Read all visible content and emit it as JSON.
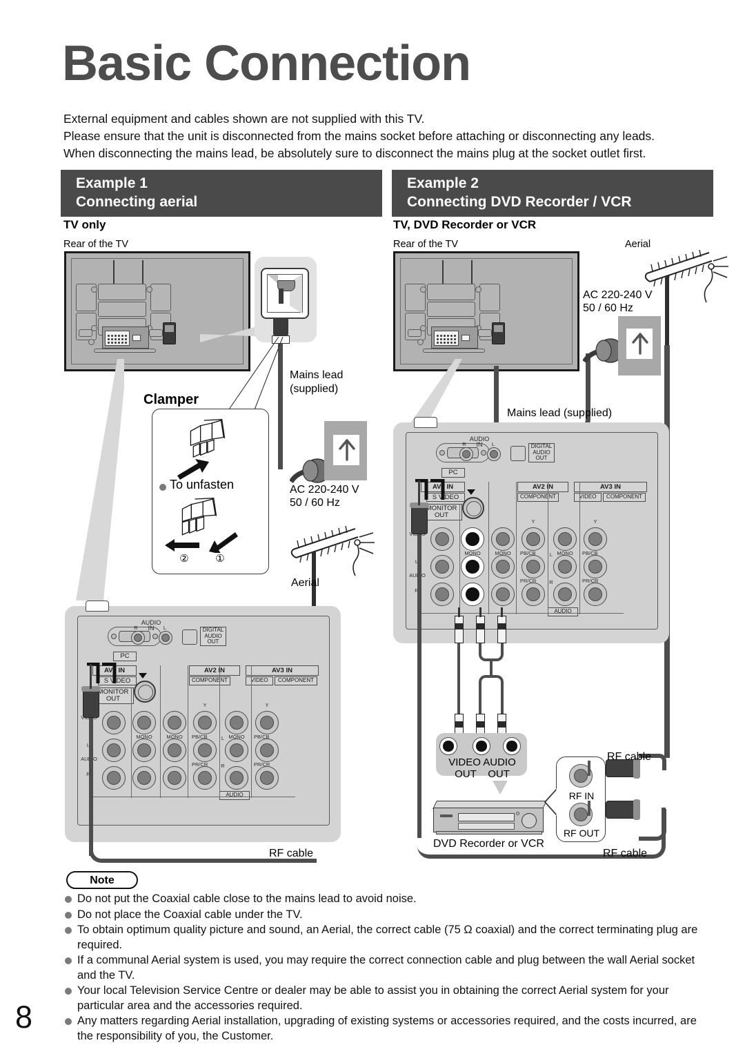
{
  "page": {
    "title": "Basic Connection",
    "page_number": "8",
    "intro_lines": [
      "External equipment and cables shown are not supplied with this TV.",
      "Please ensure that the unit is disconnected from the mains socket before attaching or disconnecting any leads.",
      "When disconnecting the mains lead, be absolutely sure to disconnect the mains plug at the socket outlet first."
    ]
  },
  "example1": {
    "header_line1": "Example 1",
    "header_line2": "Connecting aerial",
    "subtitle": "TV only",
    "tv_label": "Rear of the TV",
    "mains_lead_label": "Mains lead\n(supplied)",
    "mains_lead_line1": "Mains lead",
    "mains_lead_line2": "(supplied)",
    "ac_line1": "AC 220-240 V",
    "ac_line2": "50 / 60 Hz",
    "aerial_label": "Aerial",
    "rf_cable_label": "RF cable",
    "clamper": {
      "title": "Clamper",
      "unfasten_label": "To unfasten",
      "step1": "①",
      "step2": "②"
    }
  },
  "example2": {
    "header_line1": "Example 2",
    "header_line2": "Connecting DVD Recorder / VCR",
    "subtitle": "TV, DVD Recorder or VCR",
    "tv_label": "Rear of the TV",
    "aerial_label": "Aerial",
    "ac_line1": "AC 220-240 V",
    "ac_line2": "50 / 60 Hz",
    "mains_lead_label": "Mains lead (supplied)",
    "bubble_line1": "VIDEO AUDIO",
    "bubble_line2": "OUT      OUT",
    "bubble_video": "VIDEO",
    "bubble_audio": "AUDIO",
    "bubble_out1": "OUT",
    "bubble_out2": "OUT",
    "device_label": "DVD Recorder or VCR",
    "rf_in_label": "RF IN",
    "rf_out_label": "RF OUT",
    "rf_cable_top": "RF cable",
    "rf_cable_bottom": "RF cable"
  },
  "panel": {
    "pc_label": "PC",
    "audio_in_top": "AUDIO",
    "audio_in_mid": "IN",
    "audio_in_r": "R",
    "audio_in_l": "L",
    "digital_audio_out": "DIGITAL\nAUDIO\nOUT",
    "digital_l1": "DIGITAL",
    "digital_l2": "AUDIO",
    "digital_l3": "OUT",
    "av1_in": "AV1  IN",
    "av2_in": "AV2  IN",
    "av3_in": "AV3  IN",
    "s_video": "S VIDEO",
    "monitor_out_l1": "MONITOR",
    "monitor_out_l2": "OUT",
    "video": "VIDEO",
    "component": "COMPONENT",
    "audio_side_l": "L",
    "audio_side_label": "AUDIO",
    "audio_side_r": "R",
    "mono": "MONO",
    "y": "Y",
    "pb_cb": "PB/CB",
    "pr_cr": "PR/CR",
    "audio_bottom": "AUDIO"
  },
  "note": {
    "heading": "Note",
    "items": [
      "Do not put the Coaxial cable close to the mains lead to avoid noise.",
      "Do not place the Coaxial cable under the TV.",
      "To obtain optimum quality picture and sound, an Aerial, the correct cable (75 Ω coaxial) and the correct terminating plug are required.",
      "If a communal Aerial system is used, you may require the correct connection cable and plug between the wall Aerial socket and the TV.",
      "Your local Television Service Centre or dealer may be able to assist you in obtaining the correct Aerial system for your particular area and the accessories required.",
      "Any matters regarding Aerial installation, upgrading of existing systems or accessories required, and the costs incurred, are the responsibility of you, the Customer."
    ]
  },
  "colors": {
    "header_bar": "#4a4a4a",
    "title_gray": "#4d4d4d",
    "tv_body": "#b2b2b2",
    "panel_bg": "#d4d4d4",
    "cable": "#4d4d4d",
    "bullet": "#7a7a7a"
  }
}
